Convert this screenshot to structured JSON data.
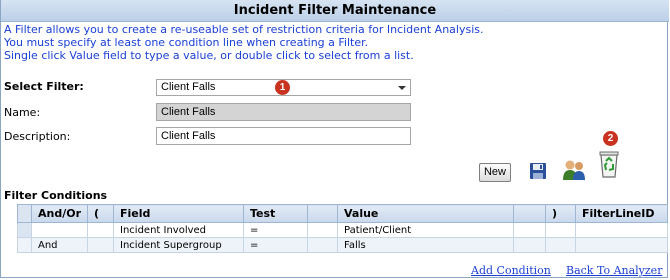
{
  "title": "Incident Filter Maintenance",
  "intro": [
    "A Filter allows you to create a re-useable set of restriction criteria for Incident Analysis.",
    "You must specify at least one condition line when creating a Filter.",
    "Single click Value field to type a value, or double click to select from a list."
  ],
  "form": {
    "select_filter_label": "Select Filter:",
    "select_filter_value": "Client Falls",
    "name_label": "Name:",
    "name_value": "Client Falls",
    "description_label": "Description:",
    "description_value": "Client Falls"
  },
  "callouts": {
    "one": "1",
    "two": "2"
  },
  "toolbar": {
    "new_label": "New",
    "icons": [
      "save-icon",
      "users-icon",
      "recycle-bin-icon"
    ]
  },
  "conditions": {
    "title": "Filter Conditions",
    "columns": [
      "And/Or",
      "(",
      "Field",
      "Test",
      "Value",
      ")",
      "FilterLineID"
    ],
    "rows": [
      {
        "andor": "",
        "open": "",
        "field": "Incident Involved",
        "test": "=",
        "value": "Patient/Client",
        "close": "",
        "id": ""
      },
      {
        "andor": "And",
        "open": "",
        "field": "Incident Supergroup",
        "test": "=",
        "value": "Falls",
        "close": "",
        "id": ""
      }
    ]
  },
  "links": {
    "add_condition": "Add Condition",
    "back": "Back To Analyzer"
  },
  "colors": {
    "accent_blue": "#1a3fd6",
    "badge_red": "#c8321f",
    "header_blue": "#c9d8ec"
  }
}
